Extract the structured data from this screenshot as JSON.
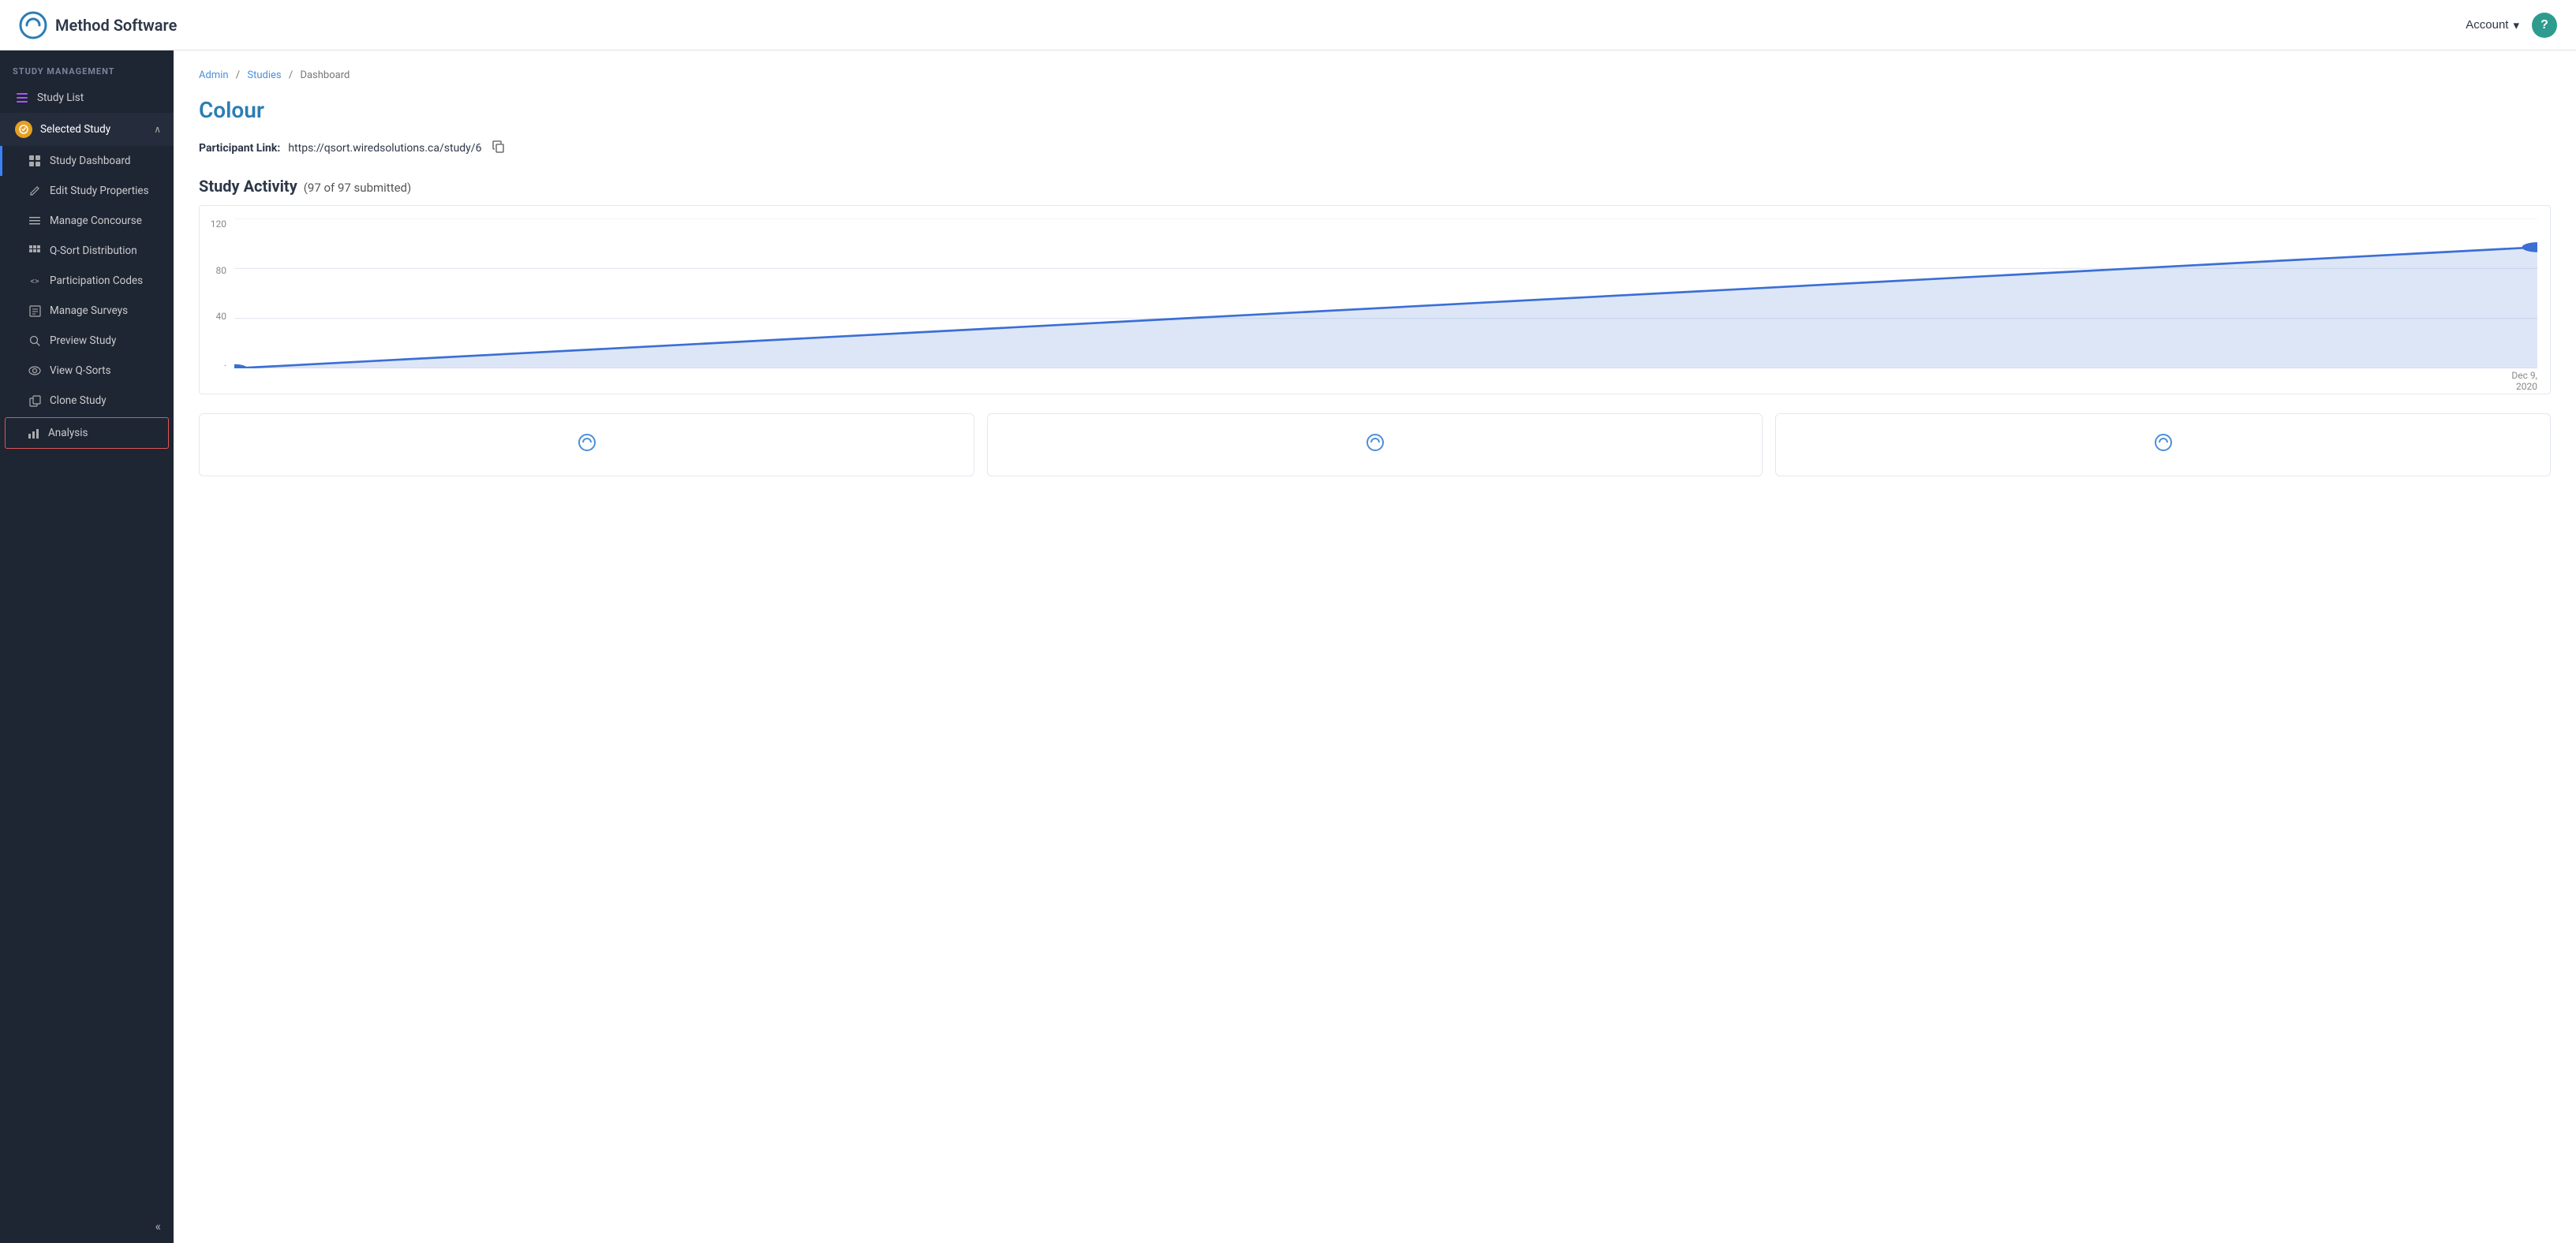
{
  "navbar": {
    "title": "Method Software",
    "account_label": "Account",
    "help_label": "?"
  },
  "breadcrumb": {
    "items": [
      "Admin",
      "Studies",
      "Dashboard"
    ],
    "separators": [
      "/",
      "/"
    ]
  },
  "page": {
    "title": "Colour",
    "participant_link_label": "Participant Link:",
    "participant_link_url": "https://qsort.wiredsolutions.ca/study/6",
    "study_activity_title": "Study Activity",
    "study_activity_sub": "(97 of 97 submitted)",
    "chart_y_labels": [
      "120",
      "80",
      "40",
      "."
    ],
    "chart_x_date": "Dec 9,\n2020"
  },
  "sidebar": {
    "section_label": "STUDY MANAGEMENT",
    "items": [
      {
        "id": "study-list",
        "label": "Study List",
        "icon": "≡",
        "sub": false,
        "active": false
      },
      {
        "id": "selected-study",
        "label": "Selected Study",
        "icon": "⚙",
        "sub": false,
        "active": true,
        "expanded": true
      },
      {
        "id": "study-dashboard",
        "label": "Study Dashboard",
        "icon": "⊞",
        "sub": true,
        "active": false
      },
      {
        "id": "edit-study-properties",
        "label": "Edit Study Properties",
        "icon": "✎",
        "sub": true,
        "active": false
      },
      {
        "id": "manage-concourse",
        "label": "Manage Concourse",
        "icon": "☰",
        "sub": true,
        "active": false
      },
      {
        "id": "q-sort-distribution",
        "label": "Q-Sort Distribution",
        "icon": "⊞",
        "sub": true,
        "active": false
      },
      {
        "id": "participation-codes",
        "label": "Participation Codes",
        "icon": "<>",
        "sub": true,
        "active": false
      },
      {
        "id": "manage-surveys",
        "label": "Manage Surveys",
        "icon": "☰",
        "sub": true,
        "active": false
      },
      {
        "id": "preview-study",
        "label": "Preview Study",
        "icon": "🔍",
        "sub": true,
        "active": false
      },
      {
        "id": "view-q-sorts",
        "label": "View Q-Sorts",
        "icon": "👁",
        "sub": true,
        "active": false
      },
      {
        "id": "clone-study",
        "label": "Clone Study",
        "icon": "⧉",
        "sub": true,
        "active": false
      },
      {
        "id": "analysis",
        "label": "Analysis",
        "icon": "📊",
        "sub": true,
        "active": true,
        "highlight": true
      }
    ],
    "collapse_label": "«"
  }
}
